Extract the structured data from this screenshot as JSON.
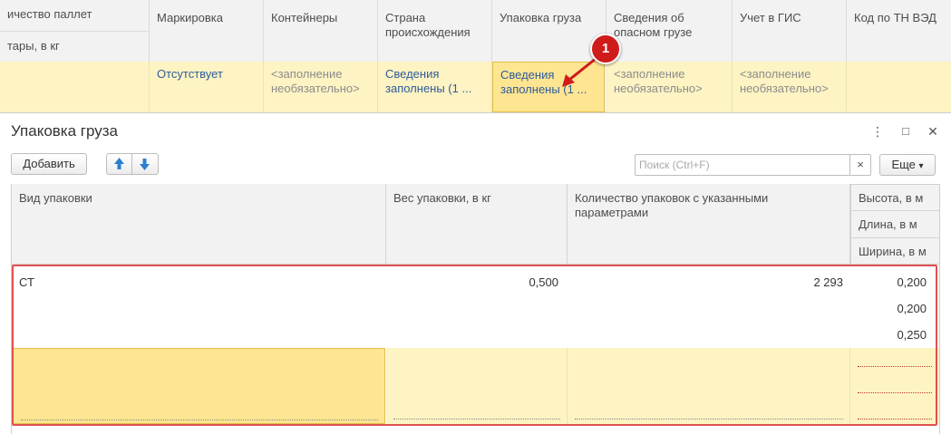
{
  "top_table": {
    "headers": {
      "pallets_qty": "ичество паллет",
      "tare_weight": "тары, в кг",
      "marking": "Маркировка",
      "containers": "Контейнеры",
      "origin_country_l1": "Страна",
      "origin_country_l2": "происхождения",
      "packaging": "Упаковка груза",
      "dangerous_l1": "Сведения об",
      "dangerous_l2": "опасном грузе",
      "gis": "Учет в ГИС",
      "tnved": "Код по ТН ВЭД"
    },
    "row": {
      "marking": "Отсутствует",
      "containers_l1": "<заполнение",
      "containers_l2": "необязательно>",
      "origin_l1": "Сведения",
      "origin_l2": "заполнены (1 ...",
      "packaging_l1": "Сведения",
      "packaging_l2": "заполнены (1 ...",
      "dangerous_l1": "<заполнение",
      "dangerous_l2": "необязательно>",
      "gis_l1": "<заполнение",
      "gis_l2": "необязательно>"
    }
  },
  "callout": {
    "number": "1",
    "color": "#d01b1b"
  },
  "dialog": {
    "title": "Упаковка груза",
    "menu_icon": "⋮",
    "maximize_icon": "□",
    "close_icon": "✕",
    "toolbar": {
      "add_label": "Добавить",
      "move_up_icon": "arrow-up-icon",
      "move_down_icon": "arrow-down-icon",
      "search_placeholder": "Поиск (Ctrl+F)",
      "search_clear": "×",
      "more_label": "Еще",
      "more_chevron": "▾"
    },
    "grid": {
      "columns": {
        "packaging_type": "Вид упаковки",
        "packaging_weight": "Вес упаковки, в кг",
        "packages_count": "Количество упаковок с указанными параметрами",
        "height": "Высота, в м",
        "length": "Длина, в м",
        "width": "Ширина, в м"
      },
      "rows": [
        {
          "packaging_type": "СТ",
          "packaging_weight": "0,500",
          "packages_count": "2 293",
          "height": "0,200",
          "length": "0,200",
          "width": "0,250"
        }
      ]
    }
  },
  "colors": {
    "row_yellow": "#fdf3c3",
    "selected_yellow": "#fde591",
    "link_blue": "#2f5c9c",
    "highlight_red": "#e0514f"
  }
}
